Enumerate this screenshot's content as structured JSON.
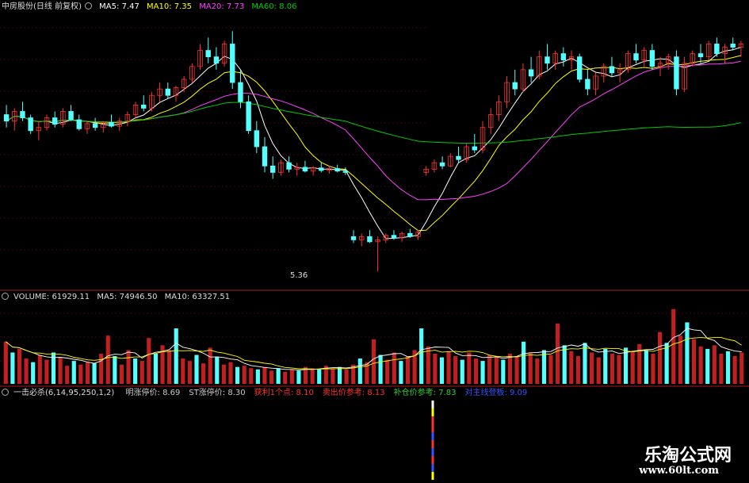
{
  "price_panel": {
    "title": "中房股份(日线 前复权)",
    "ma5_label": "MA5:",
    "ma5_value": "7.47",
    "ma10_label": "MA10:",
    "ma10_value": "7.35",
    "ma20_label": "MA20:",
    "ma20_value": "7.73",
    "ma60_label": "MA60:",
    "ma60_value": "8.06",
    "low_annotation": "5.36",
    "colors": {
      "ma5": "#ffffff",
      "ma10": "#ffff00",
      "ma20": "#ff40ff",
      "ma60": "#00cc00"
    }
  },
  "volume_panel": {
    "volume_label": "VOLUME:",
    "volume_value": "61929.11",
    "ma5_label": "MA5:",
    "ma5_value": "74946.50",
    "ma10_label": "MA10:",
    "ma10_value": "63327.51"
  },
  "indicator_panel": {
    "name": "一击必杀(6,14,95,250,1,2)",
    "items": [
      {
        "label": "明涨停价:",
        "value": "8.69",
        "color": "#cccccc"
      },
      {
        "label": "ST涨停价:",
        "value": "8.30",
        "color": "#cccccc"
      },
      {
        "label": "获利1个点:",
        "value": "8.10",
        "color": "#ff3030"
      },
      {
        "label": "卖出价参考:",
        "value": "8.13",
        "color": "#ff3030"
      },
      {
        "label": "补仓价参考:",
        "value": "7.83",
        "color": "#33cc33"
      },
      {
        "label": "对主线登板:",
        "value": "9.09",
        "color": "#3355ff"
      }
    ]
  },
  "watermark": {
    "line1": "乐淘公式网",
    "line2": "www.60lt.com"
  },
  "colors": {
    "up": "#ff3333",
    "down": "#54ffff",
    "grid": "#8b1010",
    "separator": "#b01a1a"
  },
  "chart_data": {
    "type": "candlestick",
    "title": "中房股份(日线 前复权)",
    "ylim": [
      5.2,
      9.4
    ],
    "candles": [
      [
        7.8,
        7.95,
        7.6,
        7.7
      ],
      [
        7.7,
        7.9,
        7.55,
        7.85
      ],
      [
        7.85,
        8.0,
        7.7,
        7.75
      ],
      [
        7.75,
        7.8,
        7.5,
        7.55
      ],
      [
        7.55,
        7.7,
        7.4,
        7.6
      ],
      [
        7.6,
        7.8,
        7.55,
        7.75
      ],
      [
        7.75,
        7.85,
        7.6,
        7.65
      ],
      [
        7.65,
        7.9,
        7.6,
        7.85
      ],
      [
        7.85,
        7.95,
        7.7,
        7.72
      ],
      [
        7.72,
        7.8,
        7.55,
        7.58
      ],
      [
        7.58,
        7.7,
        7.5,
        7.66
      ],
      [
        7.66,
        7.75,
        7.55,
        7.6
      ],
      [
        7.6,
        7.7,
        7.52,
        7.68
      ],
      [
        7.68,
        7.8,
        7.6,
        7.62
      ],
      [
        7.62,
        7.75,
        7.55,
        7.7
      ],
      [
        7.7,
        7.85,
        7.62,
        7.8
      ],
      [
        7.8,
        8.0,
        7.75,
        7.95
      ],
      [
        7.95,
        8.1,
        7.85,
        7.9
      ],
      [
        7.9,
        8.15,
        7.85,
        8.1
      ],
      [
        8.1,
        8.3,
        8.0,
        8.2
      ],
      [
        8.2,
        8.3,
        8.05,
        8.1
      ],
      [
        8.1,
        8.25,
        8.0,
        8.22
      ],
      [
        8.22,
        8.4,
        8.15,
        8.35
      ],
      [
        8.35,
        8.6,
        8.3,
        8.55
      ],
      [
        8.55,
        8.9,
        8.5,
        8.8
      ],
      [
        8.8,
        9.0,
        8.6,
        8.7
      ],
      [
        8.7,
        8.85,
        8.5,
        8.6
      ],
      [
        8.6,
        8.95,
        8.55,
        8.9
      ],
      [
        8.9,
        9.1,
        8.2,
        8.3
      ],
      [
        8.3,
        8.5,
        7.9,
        8.0
      ],
      [
        8.0,
        8.1,
        7.5,
        7.55
      ],
      [
        7.55,
        7.7,
        7.2,
        7.3
      ],
      [
        7.3,
        7.45,
        6.9,
        7.0
      ],
      [
        7.0,
        7.15,
        6.8,
        6.9
      ],
      [
        6.9,
        7.1,
        6.85,
        7.05
      ],
      [
        7.05,
        7.15,
        6.9,
        6.95
      ],
      [
        6.95,
        7.05,
        6.85,
        6.98
      ],
      [
        6.98,
        7.08,
        6.9,
        6.92
      ],
      [
        6.92,
        7.0,
        6.85,
        6.97
      ],
      [
        6.97,
        7.05,
        6.9,
        6.93
      ],
      [
        6.93,
        7.0,
        6.88,
        6.96
      ],
      [
        6.96,
        7.02,
        6.9,
        6.92
      ],
      [
        6.92,
        6.98,
        6.86,
        6.9
      ],
      [
        5.9,
        6.0,
        5.8,
        5.85
      ],
      [
        5.85,
        5.95,
        5.75,
        5.9
      ],
      [
        5.9,
        6.0,
        5.8,
        5.82
      ],
      [
        5.82,
        5.9,
        5.36,
        5.85
      ],
      [
        5.85,
        5.95,
        5.8,
        5.92
      ],
      [
        5.92,
        6.0,
        5.85,
        5.88
      ],
      [
        5.88,
        5.98,
        5.82,
        5.95
      ],
      [
        5.95,
        6.02,
        5.88,
        5.9
      ],
      [
        5.9,
        6.0,
        5.85,
        5.97
      ],
      [
        6.9,
        7.0,
        6.85,
        6.95
      ],
      [
        6.95,
        7.1,
        6.9,
        7.05
      ],
      [
        7.05,
        7.15,
        6.95,
        7.0
      ],
      [
        7.0,
        7.2,
        6.98,
        7.15
      ],
      [
        7.15,
        7.3,
        7.05,
        7.1
      ],
      [
        7.1,
        7.35,
        7.05,
        7.3
      ],
      [
        7.3,
        7.5,
        7.2,
        7.25
      ],
      [
        7.25,
        7.7,
        7.2,
        7.6
      ],
      [
        7.6,
        7.9,
        7.5,
        7.8
      ],
      [
        7.8,
        8.1,
        7.7,
        8.0
      ],
      [
        8.0,
        8.4,
        7.9,
        8.3
      ],
      [
        8.3,
        8.5,
        8.1,
        8.2
      ],
      [
        8.2,
        8.6,
        8.15,
        8.5
      ],
      [
        8.5,
        8.7,
        8.3,
        8.4
      ],
      [
        8.4,
        8.8,
        8.35,
        8.7
      ],
      [
        8.7,
        8.9,
        8.5,
        8.6
      ],
      [
        8.6,
        8.8,
        8.5,
        8.75
      ],
      [
        8.75,
        8.85,
        8.55,
        8.65
      ],
      [
        8.65,
        8.8,
        8.5,
        8.7
      ],
      [
        8.7,
        8.75,
        8.3,
        8.35
      ],
      [
        8.35,
        8.5,
        8.1,
        8.2
      ],
      [
        8.2,
        8.45,
        8.1,
        8.4
      ],
      [
        8.4,
        8.6,
        8.3,
        8.55
      ],
      [
        8.55,
        8.7,
        8.4,
        8.45
      ],
      [
        8.45,
        8.6,
        8.3,
        8.5
      ],
      [
        8.5,
        8.8,
        8.45,
        8.75
      ],
      [
        8.75,
        8.9,
        8.6,
        8.65
      ],
      [
        8.65,
        8.85,
        8.55,
        8.8
      ],
      [
        8.8,
        8.9,
        8.5,
        8.55
      ],
      [
        8.55,
        8.7,
        8.4,
        8.6
      ],
      [
        8.6,
        8.75,
        8.5,
        8.7
      ],
      [
        8.7,
        8.8,
        8.1,
        8.2
      ],
      [
        8.2,
        8.7,
        8.15,
        8.6
      ],
      [
        8.6,
        8.8,
        8.55,
        8.75
      ],
      [
        8.75,
        8.9,
        8.6,
        8.7
      ],
      [
        8.7,
        8.95,
        8.65,
        8.9
      ],
      [
        8.9,
        9.0,
        8.7,
        8.75
      ],
      [
        8.75,
        8.9,
        8.6,
        8.85
      ],
      [
        8.9,
        9.0,
        8.8,
        8.85
      ],
      [
        8.85,
        8.95,
        8.7,
        8.9
      ]
    ],
    "volumes": [
      3.5,
      2.6,
      2.9,
      2.1,
      1.8,
      2.4,
      2.0,
      2.6,
      2.2,
      1.5,
      1.9,
      1.6,
      1.8,
      1.7,
      2.5,
      4.0,
      2.3,
      1.6,
      2.8,
      2.1,
      1.9,
      3.8,
      2.5,
      3.2,
      2.8,
      4.6,
      2.1,
      1.9,
      2.4,
      1.7,
      3.0,
      2.2,
      1.6,
      1.8,
      1.4,
      1.5,
      1.3,
      1.2,
      1.4,
      1.1,
      1.3,
      1.0,
      1.2,
      1.1,
      1.4,
      1.3,
      1.2,
      1.5,
      1.3,
      1.4,
      1.2,
      1.6,
      2.1,
      1.8,
      3.7,
      2.4,
      2.0,
      2.6,
      1.9,
      2.3,
      2.8,
      4.6,
      3.1,
      2.5,
      2.2,
      2.7,
      2.3,
      2.0,
      2.6,
      2.1,
      1.9,
      2.4,
      2.2,
      2.0,
      2.5,
      2.3,
      3.5,
      2.6,
      2.1,
      2.8,
      2.4,
      5.0,
      3.2,
      2.7,
      2.3,
      3.4,
      2.6,
      2.2,
      2.9,
      2.5,
      2.4,
      3.0,
      2.7,
      3.3,
      2.8,
      2.5,
      4.3,
      3.4,
      6.2,
      4.0,
      5.1,
      3.7,
      3.1,
      2.9,
      3.2,
      2.5,
      2.7,
      2.3,
      2.6
    ]
  }
}
